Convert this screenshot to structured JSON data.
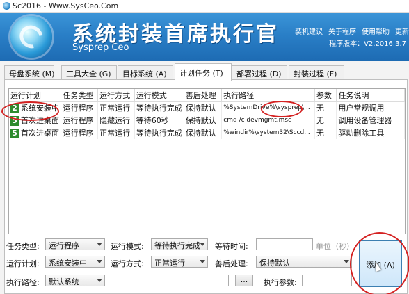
{
  "window": {
    "title": "Sc2016 - Www.SysCeo.Com"
  },
  "header": {
    "app_title": "系统封装首席执行官",
    "app_subtitle": "Sysprep Ceo",
    "links": [
      "装机建议",
      "关于程序",
      "使用帮助",
      "更新"
    ],
    "version": "程序版本：V2.2016.3.7"
  },
  "tabs": [
    {
      "label": "母盘系统 (M)"
    },
    {
      "label": "工具大全 (G)"
    },
    {
      "label": "目标系统 (A)"
    },
    {
      "label": "计划任务 (T)"
    },
    {
      "label": "部署过程 (D)"
    },
    {
      "label": "封装过程 (F)"
    }
  ],
  "table": {
    "columns": [
      "运行计划",
      "任务类型",
      "运行方式",
      "运行模式",
      "善后处理",
      "执行路径",
      "参数",
      "任务说明"
    ],
    "rows": [
      {
        "num": "2",
        "cells": [
          "系统安装中",
          "运行程序",
          "正常运行",
          "等待执行完成",
          "保持默认",
          "%SystemDrive%\\sysprep\\...",
          "无",
          "用户常规调用"
        ]
      },
      {
        "num": "5",
        "cells": [
          "首次进桌面",
          "运行程序",
          "隐藏运行",
          "等待60秒",
          "保持默认",
          "cmd /c devmgmt.msc",
          "无",
          "调用设备管理器"
        ]
      },
      {
        "num": "5",
        "cells": [
          "首次进桌面",
          "运行程序",
          "正常运行",
          "等待执行完成",
          "保持默认",
          "%windir%\\system32\\Sccd...",
          "无",
          "驱动删除工具"
        ]
      }
    ]
  },
  "form": {
    "task_type_label": "任务类型:",
    "task_type_value": "运行程序",
    "run_mode_label": "运行模式:",
    "run_mode_value": "等待执行完成",
    "wait_time_label": "等待时间:",
    "unit_hint": "单位（秒）",
    "schedule_label": "运行计划:",
    "schedule_value": "系统安装中",
    "run_style_label": "运行方式:",
    "run_style_value": "正常运行",
    "after_label": "善后处理:",
    "after_value": "保持默认",
    "path_label": "执行路径:",
    "path_value": "默认系统",
    "browse_label": "...",
    "params_label": "执行参数:",
    "add_label": "添加 (A)"
  }
}
